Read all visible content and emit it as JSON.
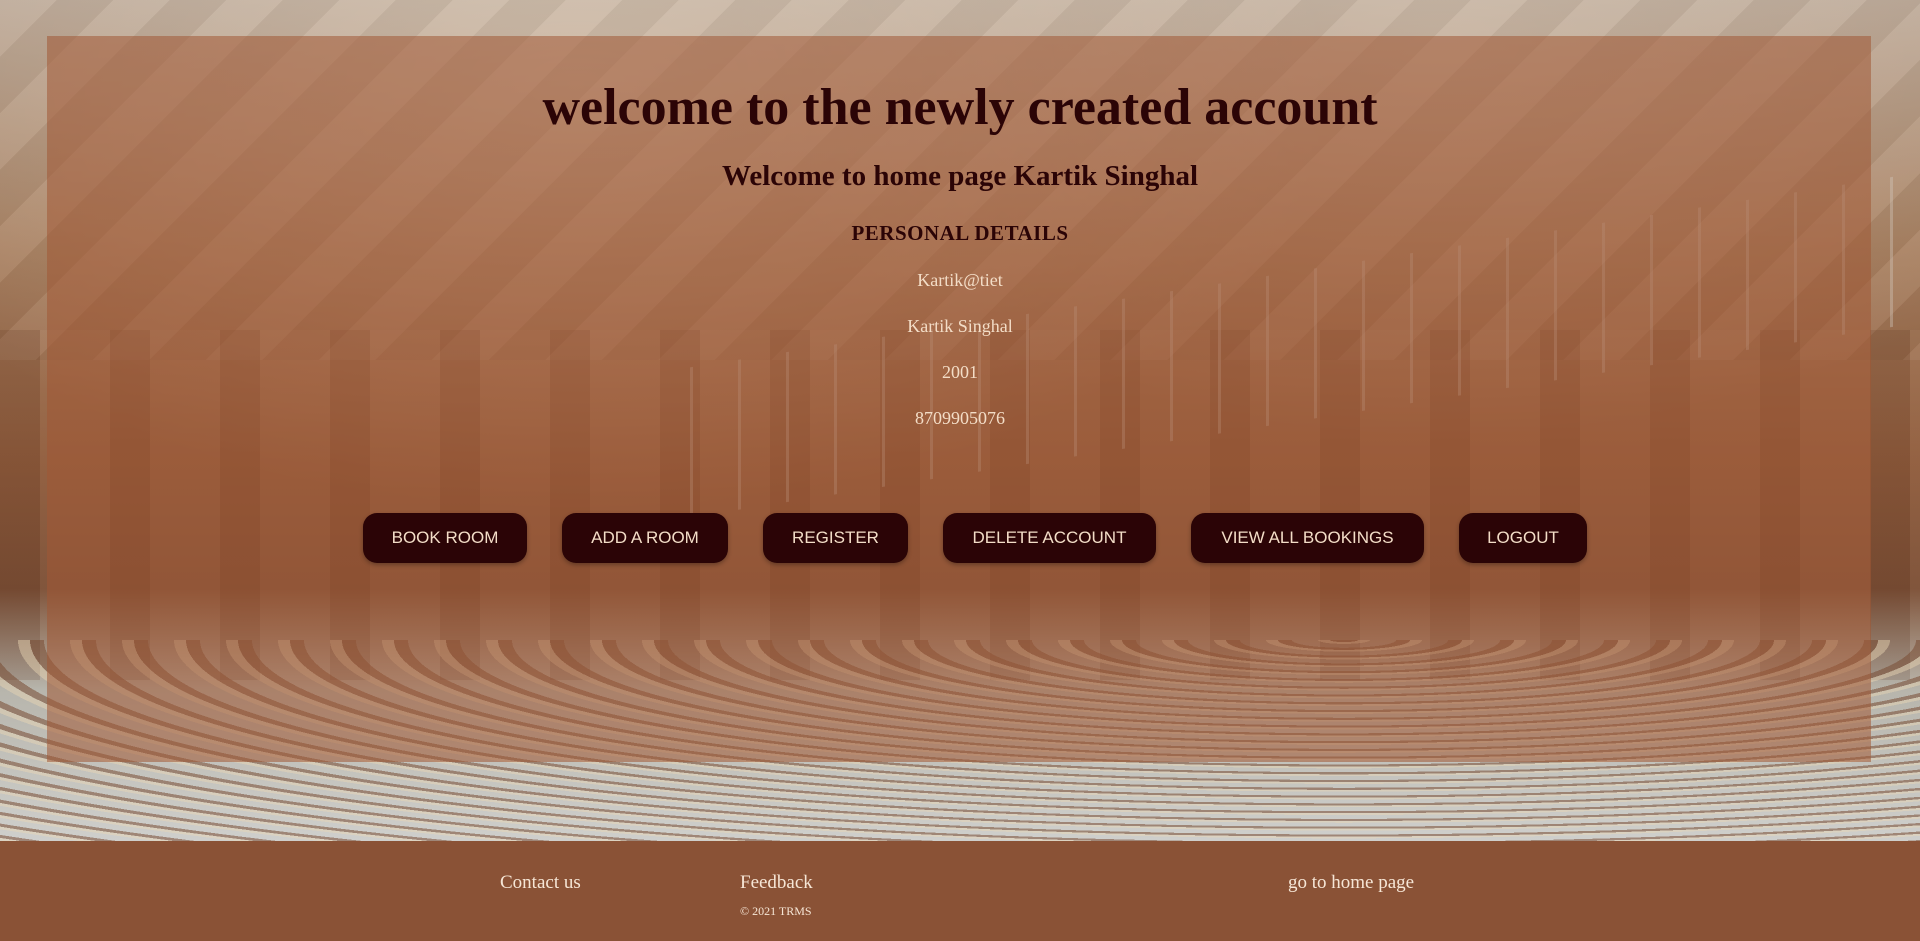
{
  "header": {
    "title": "welcome to the newly created account",
    "welcome": "Welcome to home page Kartik Singhal"
  },
  "details": {
    "heading": "PERSONAL DETAILS",
    "username": "Kartik@tiet",
    "name": "Kartik Singhal",
    "year": "2001",
    "phone": "8709905076"
  },
  "actions": {
    "book_room": "BOOK ROOM",
    "add_room": "ADD A ROOM",
    "register": "REGISTER",
    "delete_account": "DELETE ACCOUNT",
    "view_bookings": "VIEW ALL BOOKINGS",
    "logout": "LOGOUT"
  },
  "footer": {
    "contact": "Contact us",
    "feedback": "Feedback",
    "home": "go to home page",
    "copyright": "© 2021 TRMS"
  },
  "colors": {
    "overlay": "#a05834",
    "button_bg": "#2b0406",
    "button_text": "#f3ddc7",
    "footer_bg": "#8a5236"
  }
}
